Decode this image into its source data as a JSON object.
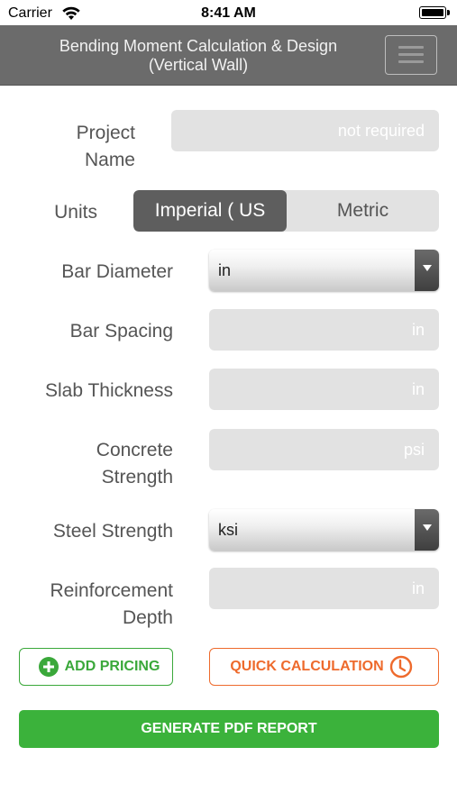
{
  "status_bar": {
    "carrier": "Carrier",
    "time": "8:41 AM"
  },
  "header": {
    "title_line1": "Bending Moment Calculation & Design",
    "title_line2": "(Vertical Wall)"
  },
  "form": {
    "project_name": {
      "label_line1": "Project",
      "label_line2": "Name",
      "placeholder": "not required"
    },
    "units": {
      "label": "Units",
      "options": [
        "Imperial ( US",
        "Metric"
      ],
      "selected": "Imperial ( US"
    },
    "bar_diameter": {
      "label": "Bar Diameter",
      "value": "in"
    },
    "bar_spacing": {
      "label": "Bar Spacing",
      "placeholder": "in"
    },
    "slab_thickness": {
      "label": "Slab Thickness",
      "placeholder": "in"
    },
    "concrete_strength": {
      "label_line1": "Concrete",
      "label_line2": "Strength",
      "placeholder": "psi"
    },
    "steel_strength": {
      "label": "Steel Strength",
      "value": "ksi"
    },
    "reinforcement_depth": {
      "label_line1": "Reinforcement",
      "label_line2": "Depth",
      "placeholder": "in"
    }
  },
  "actions": {
    "add_pricing": "ADD PRICING",
    "quick_calculation": "QUICK CALCULATION",
    "generate_pdf": "GENERATE PDF REPORT"
  },
  "colors": {
    "header_bg": "#6b6b6b",
    "green": "#3bb23b",
    "orange": "#ee6a2c",
    "field_bg": "#e2e2e2",
    "segment_active": "#5e5e5e"
  },
  "icons": [
    "wifi-icon",
    "battery-icon",
    "hamburger-menu-icon",
    "dropdown-arrow-icon",
    "plus-circle-icon",
    "clock-icon"
  ]
}
